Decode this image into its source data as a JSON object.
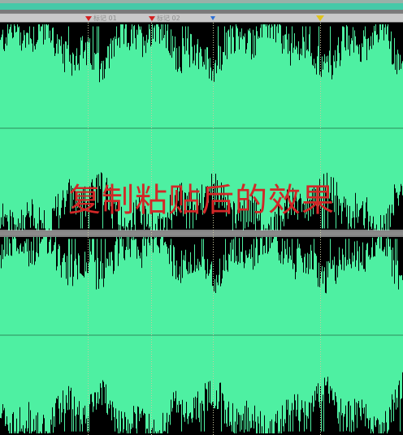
{
  "markers": [
    {
      "label": "标记 01",
      "kind": "cue",
      "time": 0.218
    },
    {
      "label": "标记 02",
      "kind": "cue",
      "time": 0.375
    },
    {
      "label": "",
      "kind": "blue",
      "time": 0.528
    },
    {
      "label": "",
      "kind": "playhead",
      "time": 0.795
    }
  ],
  "overlay": {
    "caption": "复制粘贴后的效果"
  },
  "colors": {
    "waveform": "#4ef0a2",
    "background": "#000000",
    "marker_line": "#c9c9a0",
    "gridline": "#2e8c5c",
    "channel_separator": "#8a8a8a"
  }
}
